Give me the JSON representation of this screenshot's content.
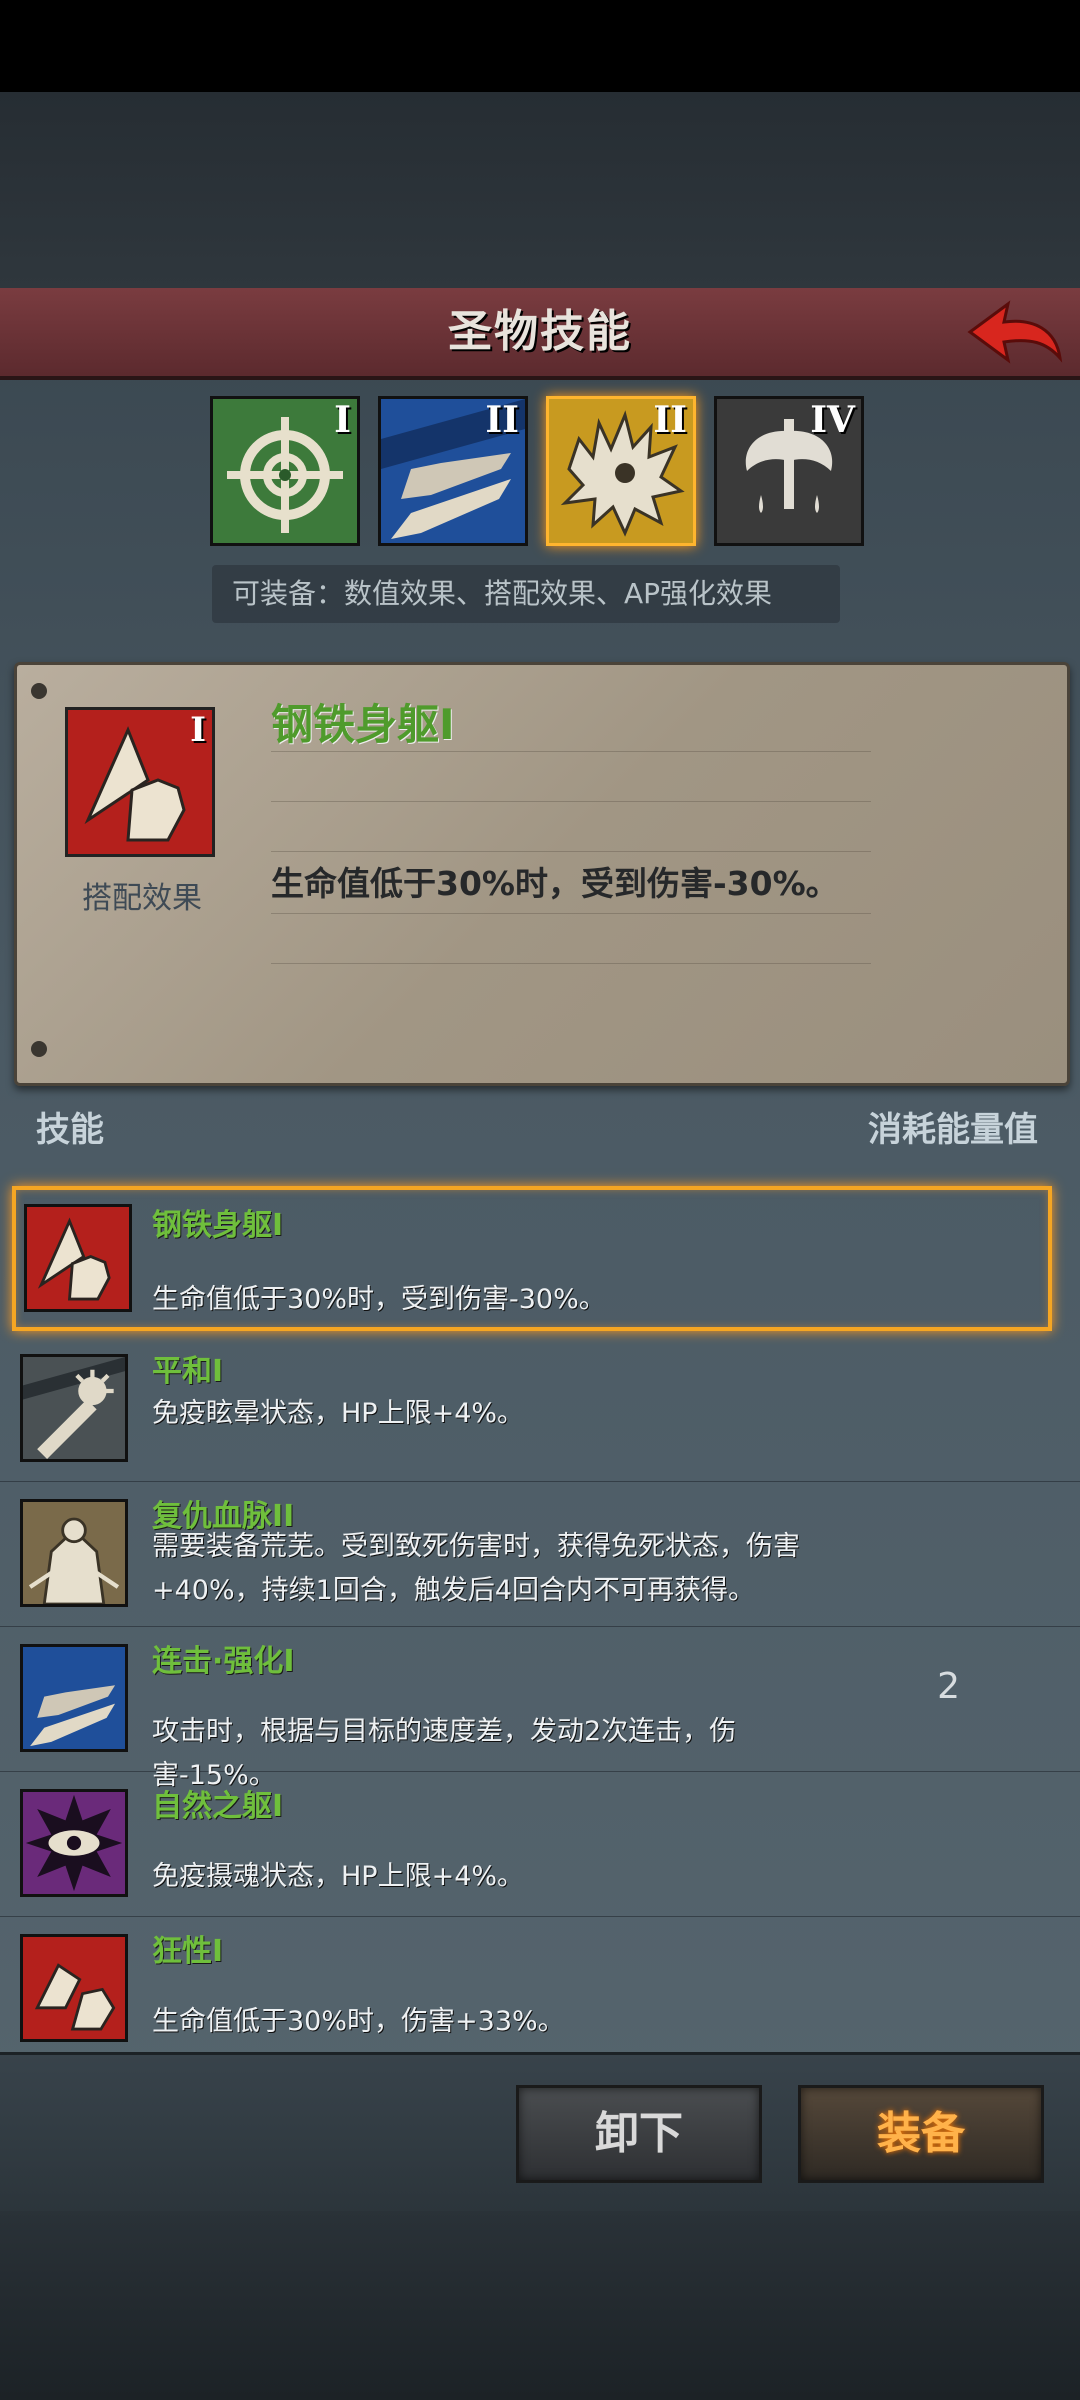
{
  "header": {
    "title": "圣物技能"
  },
  "tabs": [
    {
      "roman": "I",
      "color": "#3d7a3b",
      "icon": "crosshair-icon"
    },
    {
      "roman": "II",
      "color": "#1f4f9a",
      "icon": "combo-strike-icon"
    },
    {
      "roman": "II",
      "color": "#c89a20",
      "icon": "spiky-beast-icon",
      "selected": true
    },
    {
      "roman": "IV",
      "color": "#3a3a3a",
      "icon": "axe-blood-icon"
    }
  ],
  "equip_note": "可装备：数值效果、搭配效果、AP强化效果",
  "detail": {
    "roman": "I",
    "type_label": "搭配效果",
    "name": "钢铁身躯I",
    "desc": "生命值低于30%时，受到伤害-30%。"
  },
  "list_header": {
    "skill": "技能",
    "cost": "消耗能量值"
  },
  "skills": [
    {
      "name": "钢铁身躯I",
      "desc": "生命值低于30%时，受到伤害-30%。",
      "cost": "",
      "icon": "iron-body-icon",
      "color": "#b4201c",
      "selected": true
    },
    {
      "name": "平和I",
      "desc": "免疫眩晕状态，HP上限+4%。",
      "cost": "",
      "icon": "peace-mace-icon",
      "color": "#4a5154"
    },
    {
      "name": "复仇血脉II",
      "desc": "需要装备荒芜。受到致死伤害时，获得免死状态，伤害+40%，持续1回合，触发后4回合内不可再获得。",
      "cost": "",
      "icon": "vengeance-icon",
      "color": "#7a6a4a"
    },
    {
      "name": "连击·强化I",
      "desc": "攻击时，根据与目标的速度差，发动2次连击，伤害-15%。",
      "cost": "2",
      "icon": "combo-strike-icon",
      "color": "#1f4f9a"
    },
    {
      "name": "自然之躯I",
      "desc": "免疫摄魂状态，HP上限+4%。",
      "cost": "",
      "icon": "eye-icon",
      "color": "#6a2a7a"
    },
    {
      "name": "狂性I",
      "desc": "生命值低于30%时，伤害+33%。",
      "cost": "",
      "icon": "frenzy-icon",
      "color": "#b4201c"
    }
  ],
  "buttons": {
    "unequip": "卸下",
    "equip": "装备"
  }
}
